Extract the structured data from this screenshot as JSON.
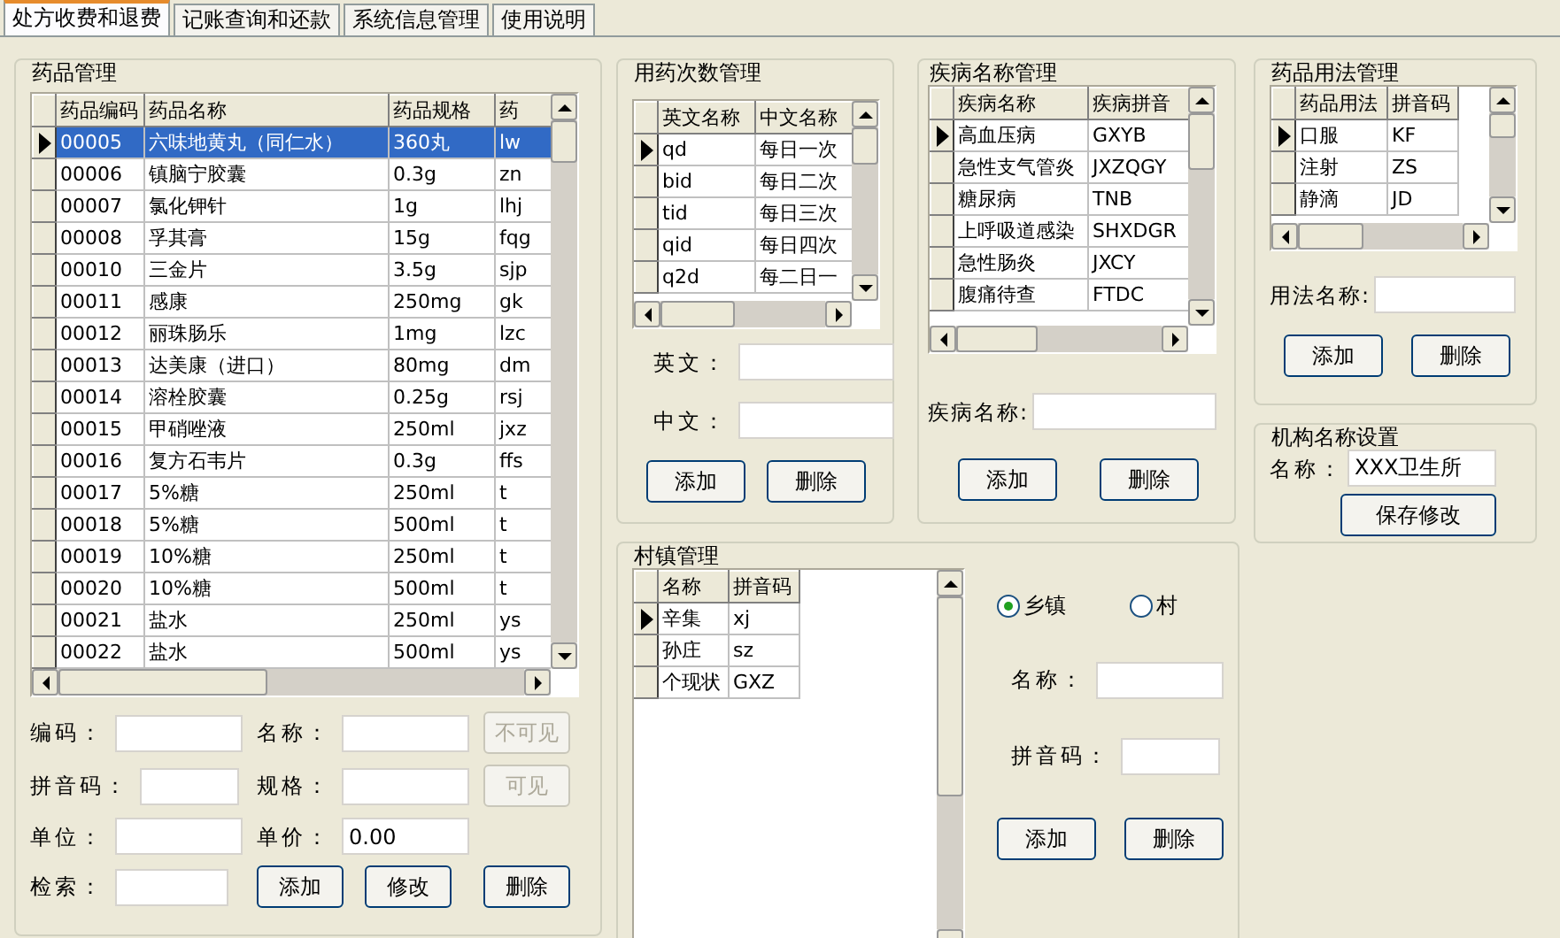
{
  "tabs": [
    {
      "label": "处方收费和退费",
      "selected": true
    },
    {
      "label": "记账查询和还款",
      "selected": false
    },
    {
      "label": "系统信息管理",
      "selected": false
    },
    {
      "label": "使用说明",
      "selected": false
    }
  ],
  "drug_management": {
    "title": "药品管理",
    "table": {
      "columns": [
        "药品编码",
        "药品名称",
        "药品规格",
        "药"
      ],
      "rows": [
        {
          "cells": [
            "00005",
            "六味地黄丸（同仁水）",
            "360丸",
            "lw"
          ],
          "selected": true
        },
        {
          "cells": [
            "00006",
            "镇脑宁胶囊",
            "0.3g",
            "zn"
          ],
          "selected": false
        },
        {
          "cells": [
            "00007",
            "氯化钾针",
            "1g",
            "lhj"
          ],
          "selected": false
        },
        {
          "cells": [
            "00008",
            "孚其膏",
            "15g",
            "fqg"
          ],
          "selected": false
        },
        {
          "cells": [
            "00010",
            "三金片",
            "3.5g",
            "sjp"
          ],
          "selected": false
        },
        {
          "cells": [
            "00011",
            "感康",
            "250mg",
            "gk"
          ],
          "selected": false
        },
        {
          "cells": [
            "00012",
            "丽珠肠乐",
            "1mg",
            "lzc"
          ],
          "selected": false
        },
        {
          "cells": [
            "00013",
            "达美康（进口）",
            "80mg",
            "dm"
          ],
          "selected": false
        },
        {
          "cells": [
            "00014",
            "溶栓胶囊",
            "0.25g",
            "rsj"
          ],
          "selected": false
        },
        {
          "cells": [
            "00015",
            "甲硝唑液",
            "250ml",
            "jxz"
          ],
          "selected": false
        },
        {
          "cells": [
            "00016",
            "复方石韦片",
            "0.3g",
            "ffs"
          ],
          "selected": false
        },
        {
          "cells": [
            "00017",
            "5%糖",
            "250ml",
            "t"
          ],
          "selected": false
        },
        {
          "cells": [
            "00018",
            "5%糖",
            "500ml",
            "t"
          ],
          "selected": false
        },
        {
          "cells": [
            "00019",
            "10%糖",
            "250ml",
            "t"
          ],
          "selected": false
        },
        {
          "cells": [
            "00020",
            "10%糖",
            "500ml",
            "t"
          ],
          "selected": false
        },
        {
          "cells": [
            "00021",
            "盐水",
            "250ml",
            "ys"
          ],
          "selected": false
        },
        {
          "cells": [
            "00022",
            "盐水",
            "500ml",
            "ys"
          ],
          "selected": false
        }
      ]
    },
    "fields": [
      {
        "label": "编码："
      },
      {
        "label": "名称："
      },
      {
        "label": "拼音码："
      },
      {
        "label": "规格："
      },
      {
        "label": "单位："
      },
      {
        "label": "单价：",
        "value": "0.00"
      },
      {
        "label": "检索："
      }
    ],
    "buttons": [
      {
        "label": "不可见",
        "disabled": true
      },
      {
        "label": "可见",
        "disabled": true
      },
      {
        "label": "添加",
        "disabled": false
      },
      {
        "label": "修改",
        "disabled": false
      },
      {
        "label": "删除",
        "disabled": false
      }
    ]
  },
  "frequency_management": {
    "title": "用药次数管理",
    "table": {
      "columns": [
        "英文名称",
        "中文名称"
      ],
      "rows": [
        {
          "cells": [
            "qd",
            "每日一次"
          ],
          "selected": true
        },
        {
          "cells": [
            "bid",
            "每日二次"
          ],
          "selected": false
        },
        {
          "cells": [
            "tid",
            "每日三次"
          ],
          "selected": false
        },
        {
          "cells": [
            "qid",
            "每日四次"
          ],
          "selected": false
        },
        {
          "cells": [
            "q2d",
            "每二日一"
          ],
          "selected": false
        }
      ]
    },
    "fields": [
      {
        "label": "英文："
      },
      {
        "label": "中文："
      }
    ],
    "buttons": [
      {
        "label": "添加",
        "disabled": false
      },
      {
        "label": "删除",
        "disabled": false
      }
    ]
  },
  "disease_management": {
    "title": "疾病名称管理",
    "table": {
      "columns": [
        "疾病名称",
        "疾病拼音"
      ],
      "rows": [
        {
          "cells": [
            "高血压病",
            "GXYB"
          ],
          "selected": true
        },
        {
          "cells": [
            "急性支气管炎",
            "JXZQGY"
          ],
          "selected": false
        },
        {
          "cells": [
            "糖尿病",
            "TNB"
          ],
          "selected": false
        },
        {
          "cells": [
            "上呼吸道感染",
            "SHXDGR"
          ],
          "selected": false
        },
        {
          "cells": [
            "急性肠炎",
            "JXCY"
          ],
          "selected": false
        },
        {
          "cells": [
            "腹痛待查",
            "FTDC"
          ],
          "selected": false
        }
      ]
    },
    "fields": [
      {
        "label": "疾病名称:"
      }
    ],
    "buttons": [
      {
        "label": "添加",
        "disabled": false
      },
      {
        "label": "删除",
        "disabled": false
      }
    ]
  },
  "usage_management": {
    "title": "药品用法管理",
    "table": {
      "columns": [
        "药品用法",
        "拼音码"
      ],
      "rows": [
        {
          "cells": [
            "口服",
            "KF"
          ],
          "selected": true
        },
        {
          "cells": [
            "注射",
            "ZS"
          ],
          "selected": false
        },
        {
          "cells": [
            "静滴",
            "JD"
          ],
          "selected": false
        }
      ]
    },
    "fields": [
      {
        "label": "用法名称:"
      }
    ],
    "buttons": [
      {
        "label": "添加",
        "disabled": false
      },
      {
        "label": "删除",
        "disabled": false
      }
    ]
  },
  "institution_settings": {
    "title": "机构名称设置",
    "fields": [
      {
        "label": "名称：",
        "value": "XXX卫生所"
      }
    ],
    "buttons": [
      {
        "label": "保存修改",
        "disabled": false
      }
    ]
  },
  "village_management": {
    "title": "村镇管理",
    "table": {
      "columns": [
        "名称",
        "拼音码"
      ],
      "rows": [
        {
          "cells": [
            "辛集",
            "xj"
          ],
          "selected": true
        },
        {
          "cells": [
            "孙庄",
            "sz"
          ],
          "selected": false
        },
        {
          "cells": [
            "个现状",
            "GXZ"
          ],
          "selected": false
        }
      ]
    },
    "types": [
      {
        "label": "乡镇",
        "selected": true
      },
      {
        "label": "村",
        "selected": false
      }
    ],
    "fields": [
      {
        "label": "名称："
      },
      {
        "label": "拼音码："
      }
    ],
    "buttons": [
      {
        "label": "添加",
        "disabled": false
      },
      {
        "label": "删除",
        "disabled": false
      }
    ]
  }
}
